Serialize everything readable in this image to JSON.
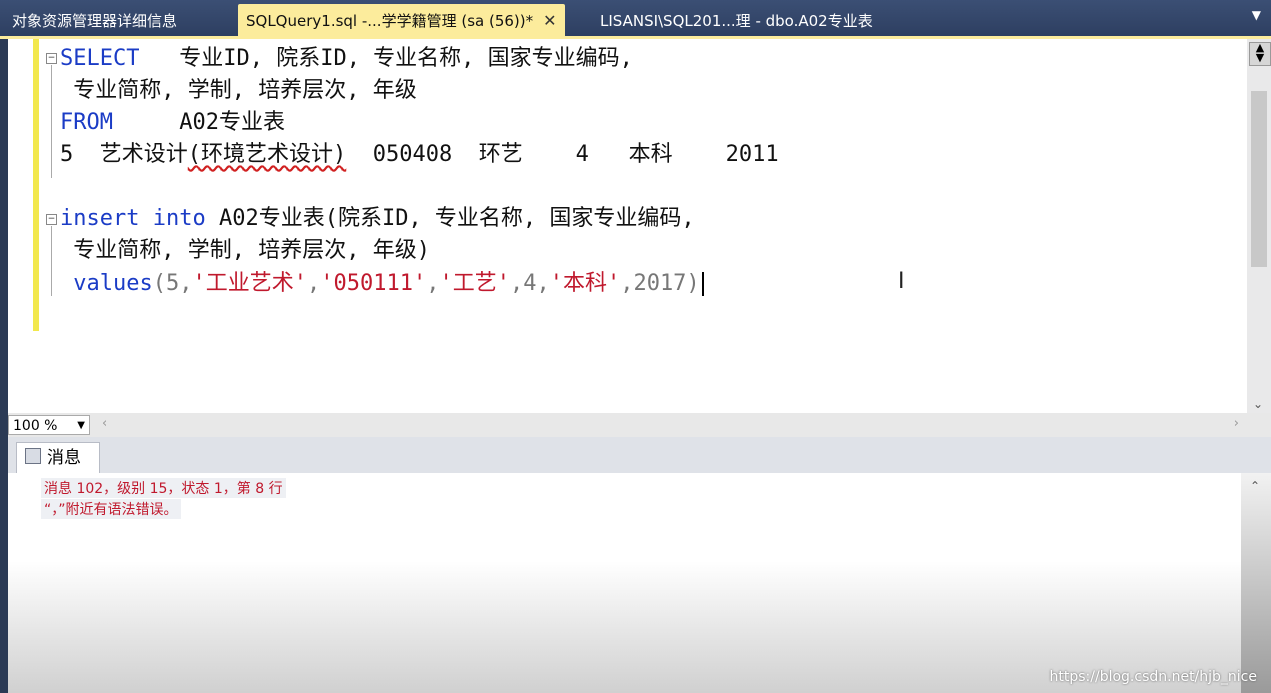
{
  "tabs": {
    "object_explorer": "对象资源管理器详细信息",
    "query": "SQLQuery1.sql -...学学籍管理 (sa (56))*",
    "query_close": "✕",
    "table": "LISANSI\\SQL201...理 - dbo.A02专业表"
  },
  "editor": {
    "l1_kw": "SELECT",
    "l1_rest": "   专业ID, 院系ID, 专业名称, 国家专业编码,",
    "l2": " 专业简称, 学制, 培养层次, 年级",
    "l3_kw": "FROM",
    "l3_rest": "     A02专业表",
    "l4_a": "5  艺术设计",
    "l4_b": "(环境艺术设计)",
    "l4_c": "  050408  环艺    4   本科    2011",
    "l6_kw1": "insert",
    "l6_kw2": "into",
    "l6_rest": " A02专业表(院系ID, 专业名称, 国家专业编码,",
    "l7": " 专业简称, 学制, 培养层次, 年级)",
    "l8_kw": "values",
    "l8_p1": "(5,",
    "l8_s1": "'工业艺术'",
    "l8_p2": ",",
    "l8_s2": "'050111'",
    "l8_p3": ",",
    "l8_s3": "'工艺'",
    "l8_p4": ",4,",
    "l8_s4": "'本科'",
    "l8_p5": ",2017)"
  },
  "zoom": {
    "value": "100 %"
  },
  "results": {
    "tab_label": "消息",
    "error_line1": "消息 102，级别 15，状态 1，第 8 行",
    "error_line2": "“，”附近有语法错误。"
  },
  "watermark": "https://blog.csdn.net/hjb_nice",
  "colors": {
    "keyword": "#1b3cc6",
    "string": "#c0192d",
    "active_tab": "#fcec9c",
    "tab_strip": "#2d3e60"
  }
}
